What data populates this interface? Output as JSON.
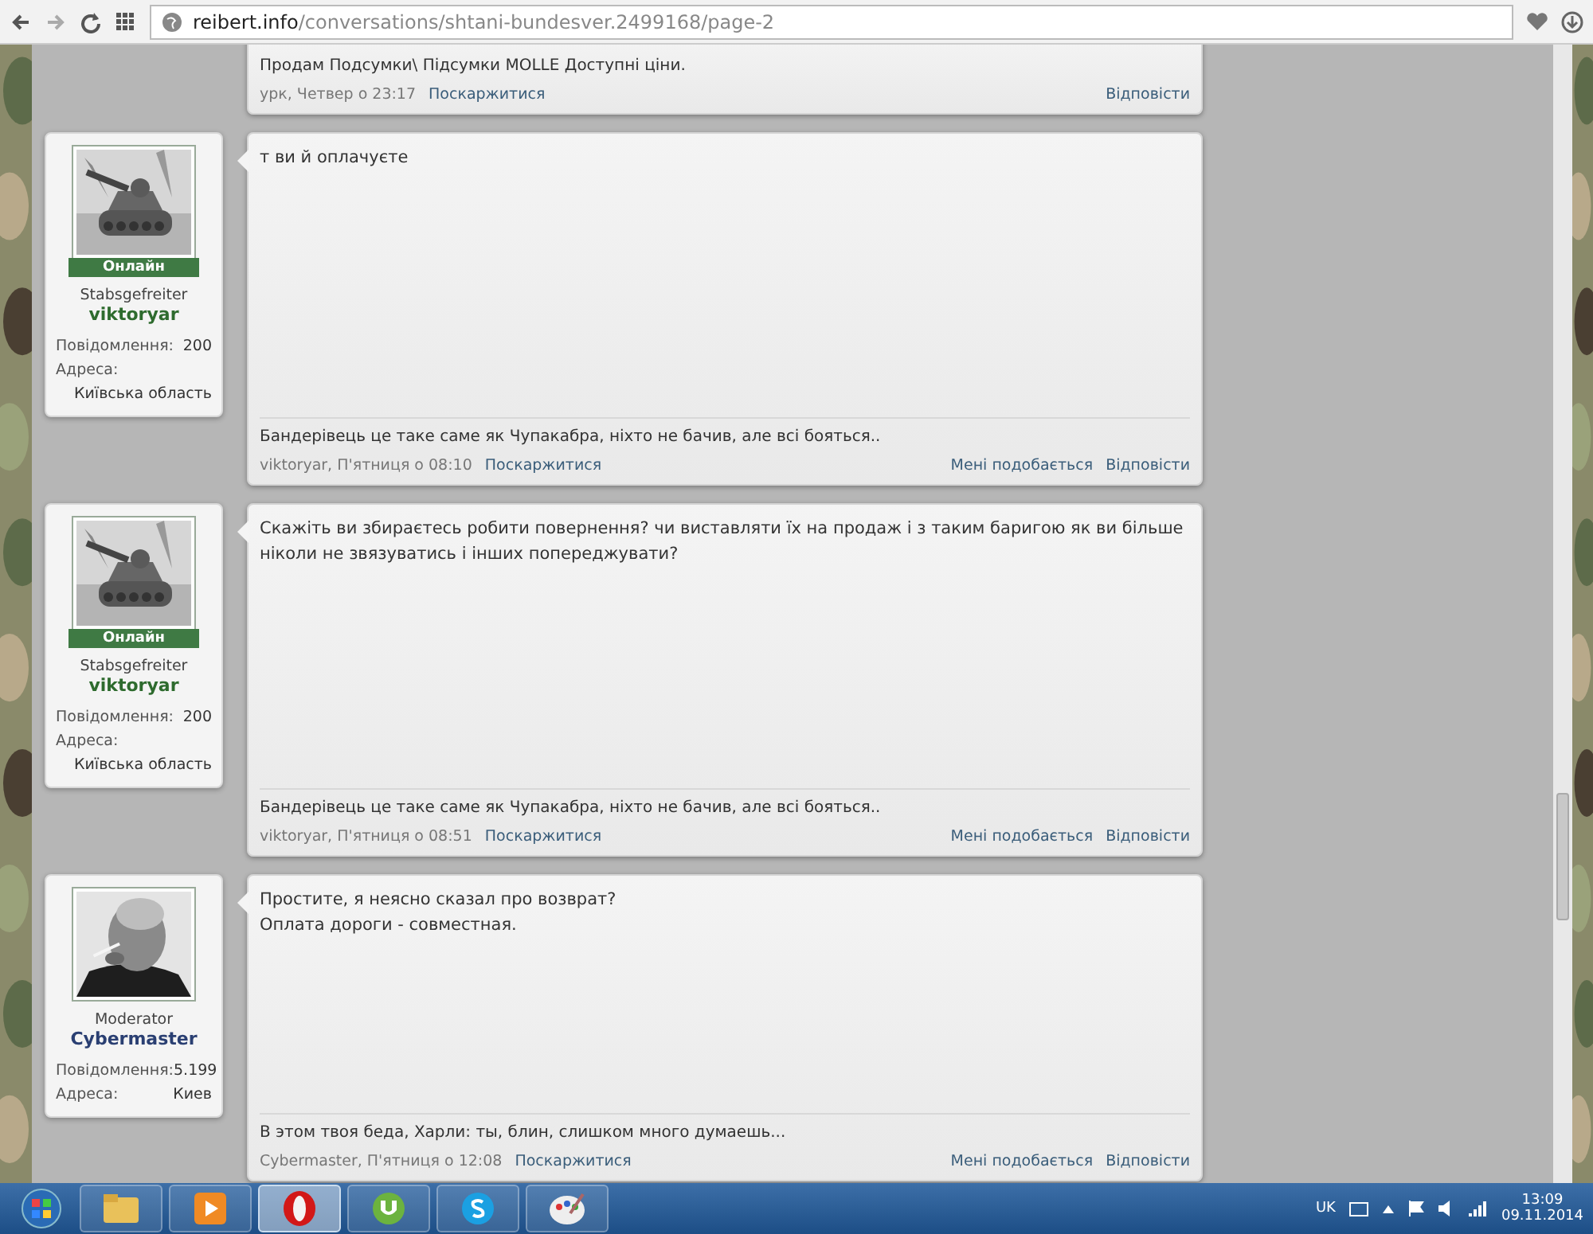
{
  "browser": {
    "url_host": "reibert.info",
    "url_path": "/conversations/shtani-bundesver.2499168/page-2"
  },
  "messages": [
    {
      "kind": "partial",
      "signature": "Продам Подсумки\\ Підсумки MOLLE Доступні ціни.",
      "meta": "урк, Четвер о 23:17",
      "report": "Поскаржитися",
      "actions": [
        "Відповісти"
      ]
    },
    {
      "kind": "full",
      "user": {
        "kind": "member",
        "online": "Онлайн",
        "rank": "Stabsgefreiter",
        "name": "viktoryar",
        "stats": [
          {
            "kind": "inline",
            "label": "Повідомлення:",
            "value": "200"
          },
          {
            "kind": "block",
            "label": "Адреса:",
            "value": "Київська область"
          }
        ]
      },
      "body": [
        "т ви й оплачуєте"
      ],
      "signature": "Бандерівець це таке саме як Чупакабра, ніхто не бачив, але всі бояться..",
      "meta": "viktoryar, П'ятниця о 08:10",
      "report": "Поскаржитися",
      "actions": [
        "Мені подобається",
        "Відповісти"
      ]
    },
    {
      "kind": "full",
      "user": {
        "kind": "member",
        "online": "Онлайн",
        "rank": "Stabsgefreiter",
        "name": "viktoryar",
        "stats": [
          {
            "kind": "inline",
            "label": "Повідомлення:",
            "value": "200"
          },
          {
            "kind": "block",
            "label": "Адреса:",
            "value": "Київська область"
          }
        ]
      },
      "body": [
        "Скажіть ви збираєтесь робити повернення? чи виставляти їх на продаж і з таким баригою як ви більше ніколи не звязуватись і інших попереджувати?"
      ],
      "signature": "Бандерівець це таке саме як Чупакабра, ніхто не бачив, але всі бояться..",
      "meta": "viktoryar, П'ятниця о 08:51",
      "report": "Поскаржитися",
      "actions": [
        "Мені подобається",
        "Відповісти"
      ]
    },
    {
      "kind": "last",
      "user": {
        "kind": "moderator",
        "rank": "Moderator",
        "name": "Cybermaster",
        "stats": [
          {
            "kind": "inline",
            "label": "Повідомлення:",
            "value": "5.199"
          },
          {
            "kind": "inline",
            "label": "Адреса:",
            "value": "Киев"
          }
        ]
      },
      "body": [
        "Простите, я неясно сказал про возврат?",
        "Оплата дороги - совместная."
      ],
      "signature": "В этом твоя беда, Харли: ты, блин, слишком много думаешь...",
      "meta": "Cybermaster, П'ятниця о 12:08",
      "report": "Поскаржитися",
      "actions": [
        "Мені подобається",
        "Відповісти"
      ]
    }
  ],
  "taskbar": {
    "apps": [
      {
        "kind": "explorer",
        "selected": false
      },
      {
        "kind": "media",
        "selected": false
      },
      {
        "kind": "opera",
        "selected": true
      },
      {
        "kind": "torrent",
        "selected": false
      },
      {
        "kind": "skype",
        "selected": false
      },
      {
        "kind": "paint",
        "selected": false
      }
    ],
    "language": "UK",
    "time": "13:09",
    "date": "09.11.2014"
  }
}
